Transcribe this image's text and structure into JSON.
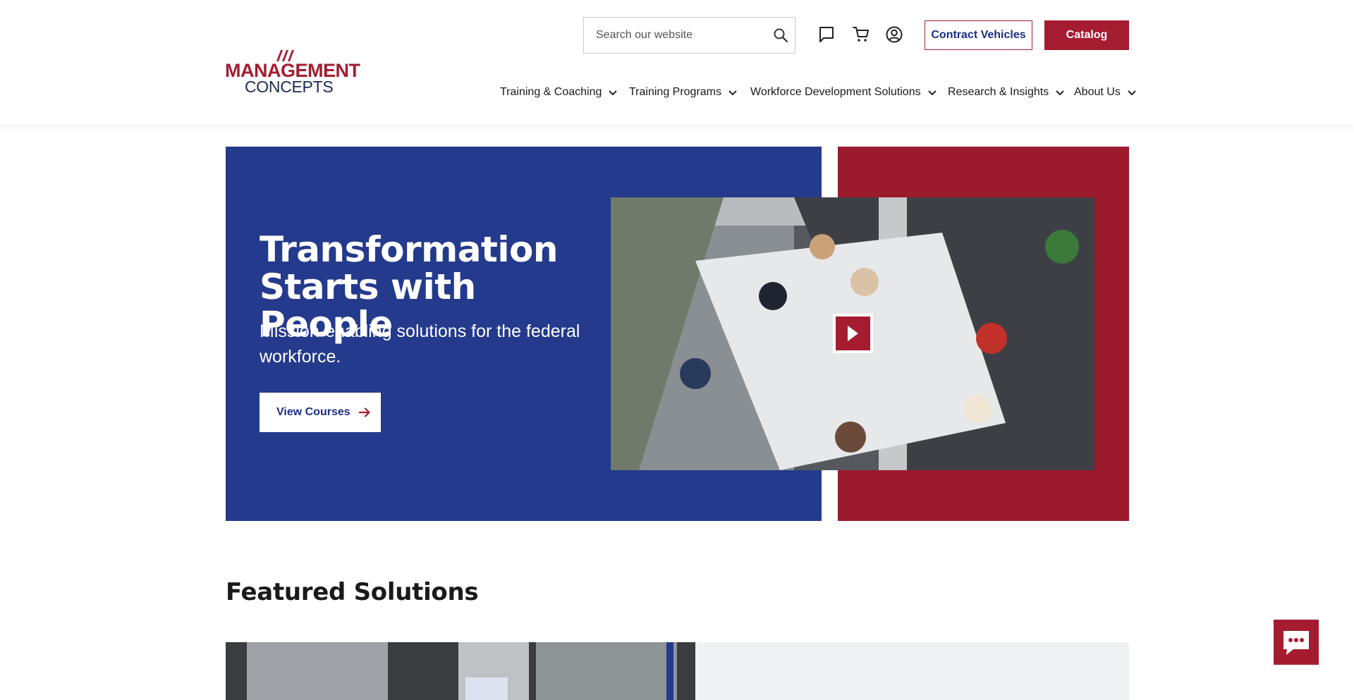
{
  "brand": {
    "logo_line1": "MANAGEMENT",
    "logo_line2": "CONCEPTS",
    "accent_red": "#a51c30",
    "brand_blue": "#243a8c",
    "hero_red": "#9b1a2e"
  },
  "header": {
    "search_placeholder": "Search our website",
    "icons": [
      "search-icon",
      "chat-bubble-icon",
      "cart-icon",
      "account-icon"
    ],
    "contract_label": "Contract Vehicles",
    "catalog_label": "Catalog"
  },
  "nav": {
    "items": [
      {
        "label": "Training & Coaching"
      },
      {
        "label": "Training Programs"
      },
      {
        "label": "Workforce Development Solutions"
      },
      {
        "label": "Research & Insights"
      },
      {
        "label": "About Us"
      }
    ]
  },
  "hero": {
    "title": "Transformation Starts with People",
    "subtitle": "Mission-enabling solutions for the federal workforce.",
    "cta_label": "View Courses"
  },
  "featured": {
    "title": "Featured Solutions"
  }
}
